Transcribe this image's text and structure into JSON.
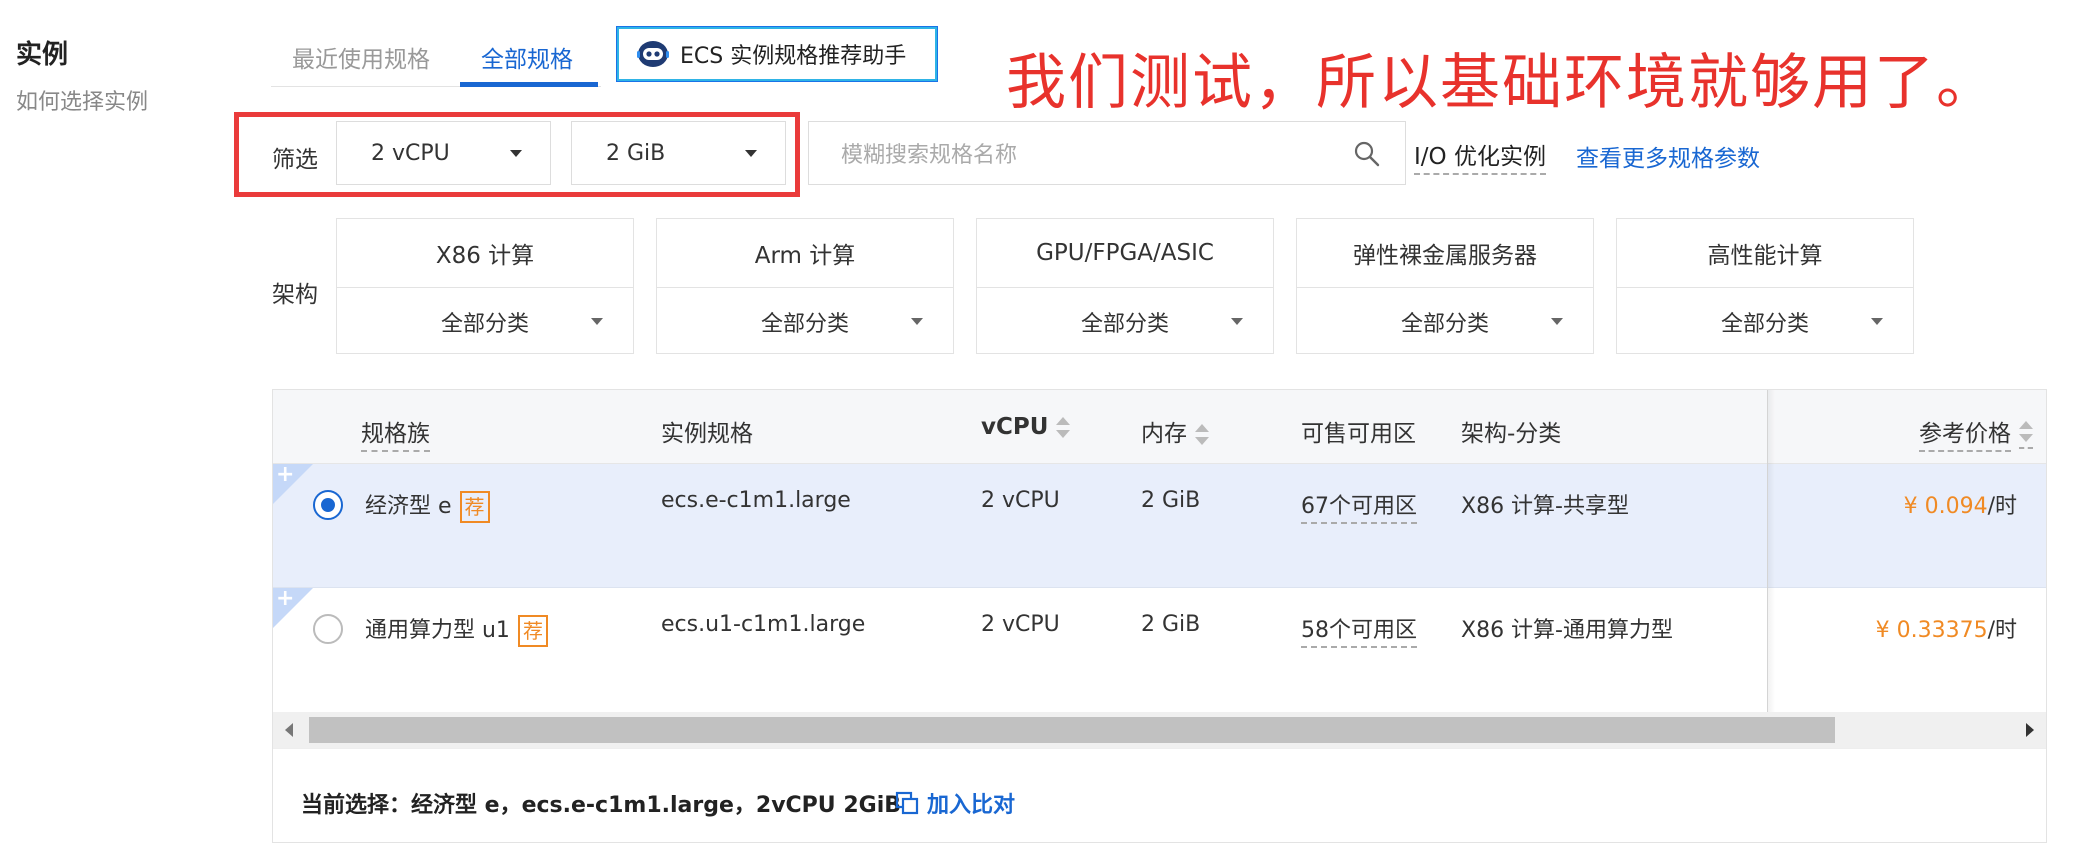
{
  "section": {
    "title": "实例",
    "help_link": "如何选择实例"
  },
  "tabs": [
    {
      "label": "最近使用规格",
      "active": false
    },
    {
      "label": "全部规格",
      "active": true
    }
  ],
  "assistant_button": {
    "label": "ECS 实例规格推荐助手",
    "icon": "robot-icon"
  },
  "annotation": {
    "text": "我们测试，所以基础环境就够用了。",
    "color": "#e8322c"
  },
  "filter": {
    "label": "筛选",
    "vcpu_select": "2 vCPU",
    "memory_select": "2 GiB",
    "search_placeholder": "模糊搜索规格名称",
    "io_optimized": "I/O 优化实例",
    "more_params_link": "查看更多规格参数"
  },
  "architecture": {
    "label": "架构",
    "cards": [
      {
        "title": "X86 计算",
        "sub": "全部分类"
      },
      {
        "title": "Arm 计算",
        "sub": "全部分类"
      },
      {
        "title": "GPU/FPGA/ASIC",
        "sub": "全部分类"
      },
      {
        "title": "弹性裸金属服务器",
        "sub": "全部分类"
      },
      {
        "title": "高性能计算",
        "sub": "全部分类"
      }
    ]
  },
  "table": {
    "headers": {
      "family": "规格族",
      "spec": "实例规格",
      "vcpu": "vCPU",
      "memory": "内存",
      "zones": "可售可用区",
      "arch": "架构-分类",
      "price": "参考价格"
    },
    "rows": [
      {
        "selected": true,
        "family": "经济型 e",
        "badge": "荐",
        "spec": "ecs.e-c1m1.large",
        "vcpu": "2 vCPU",
        "memory": "2 GiB",
        "zones": "67个可用区",
        "arch": "X86 计算-共享型",
        "price": "¥ 0.094",
        "price_unit": "/时"
      },
      {
        "selected": false,
        "family": "通用算力型 u1",
        "badge": "荐",
        "spec": "ecs.u1-c1m1.large",
        "vcpu": "2 vCPU",
        "memory": "2 GiB",
        "zones": "58个可用区",
        "arch": "X86 计算-通用算力型",
        "price": "¥ 0.33375",
        "price_unit": "/时"
      }
    ],
    "corner_glyph": "+"
  },
  "footer": {
    "current_selection": "当前选择：经济型 e，ecs.e-c1m1.large，2vCPU 2GiB",
    "compare_label": "加入比对"
  },
  "colors": {
    "accent": "#1967d2",
    "price": "#f08a24",
    "selected_row": "#e8eefb",
    "highlight_box": "#ea3b3b"
  }
}
